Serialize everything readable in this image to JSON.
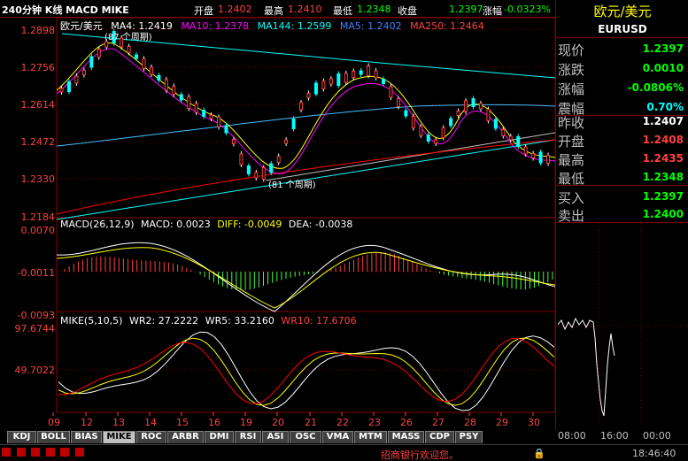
{
  "titlebar": {
    "title": "240分钟 K线 MACD MIKE",
    "open_label": "开盘",
    "open_value": "1.2402",
    "high_label": "最高",
    "high_value": "1.2410",
    "low_label": "最低",
    "low_value": "1.2348",
    "close_label": "收盘",
    "close_value": "1.2397",
    "change_label": "涨幅",
    "change_value": "-0.0323%"
  },
  "main_panel": {
    "legend": {
      "symbol": "欧元/美元",
      "ma4": "MA4: 1.2419",
      "ma10": "MA10: 1.2378",
      "ma144": "MA144: 1.2599",
      "ma5": "MA5: 1.2402",
      "ma250": "MA250: 1.2464"
    },
    "price_axis": [
      "1.2898",
      "1.2756",
      "1.2614",
      "1.2472",
      "1.2330",
      "1.2184"
    ],
    "annotations": {
      "peak": "(87 个周期)",
      "trough": "(81 个周期)"
    }
  },
  "macd_panel": {
    "legend": {
      "title": "MACD(26,12,9)",
      "macd": "MACD: 0.0023",
      "diff": "DIFF: -0.0049",
      "dea": "DEA: -0.0038"
    },
    "axis": [
      "0.0070",
      "-0.0011",
      "-0.0093"
    ]
  },
  "mike_panel": {
    "legend": {
      "title": "MIKE(5,10,5)",
      "wr2": "WR2: 27.2222",
      "wr5": "WR5: 33.2160",
      "wr10": "WR10: 17.6706"
    },
    "axis": [
      "97.6744",
      "49.7022"
    ]
  },
  "x_axis": [
    "09",
    "12",
    "13",
    "14",
    "15",
    "16",
    "19",
    "20",
    "21",
    "22",
    "23",
    "26",
    "27",
    "28",
    "29",
    "30"
  ],
  "tabs": [
    "KDJ",
    "BOLL",
    "BIAS",
    "MIKE",
    "ROC",
    "ARBR",
    "DMI",
    "RSI",
    "ASI",
    "OSC",
    "VMA",
    "MTM",
    "MASS",
    "CDP",
    "PSY"
  ],
  "active_tab": "MIKE",
  "sidepanel": {
    "name": "欧元/美元",
    "code": "EURUSD",
    "rows": [
      {
        "label": "现价",
        "value": "1.2397",
        "color": "#00ff00"
      },
      {
        "label": "涨跌",
        "value": "0.0010",
        "color": "#00ff00"
      },
      {
        "label": "涨幅",
        "value": "-0.0806%",
        "color": "#00ff00"
      },
      {
        "label": "震幅",
        "value": "0.70%",
        "color": "#00ffff"
      },
      {
        "label": "昨收",
        "value": "1.2407",
        "color": "#ffffff"
      },
      {
        "label": "开盘",
        "value": "1.2408",
        "color": "#ff4040"
      },
      {
        "label": "最高",
        "value": "1.2435",
        "color": "#ff4040"
      },
      {
        "label": "最低",
        "value": "1.2348",
        "color": "#00ff00"
      },
      {
        "label": "买入",
        "value": "1.2397",
        "color": "#00ff00"
      },
      {
        "label": "卖出",
        "value": "1.2400",
        "color": "#00ff00"
      }
    ],
    "time_axis": [
      "08:00",
      "16:00",
      "00:00"
    ]
  },
  "statusbar": {
    "message": "招商银行欢迎您。",
    "time": "18:46:40"
  }
}
